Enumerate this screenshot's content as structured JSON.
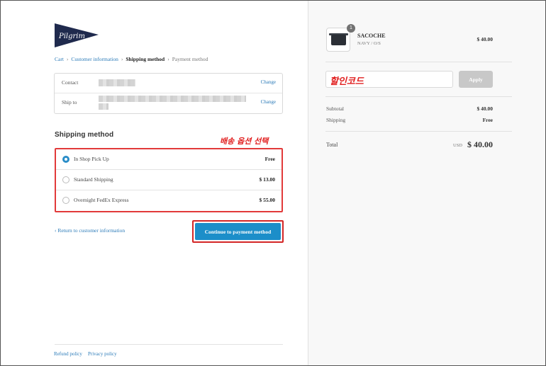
{
  "brand": {
    "logo_text": "Pilgrim"
  },
  "breadcrumb": {
    "items": [
      "Cart",
      "Customer information",
      "Shipping method",
      "Payment method"
    ]
  },
  "review": {
    "contact_label": "Contact",
    "ship_to_label": "Ship to",
    "change_label": "Change"
  },
  "shipping": {
    "title": "Shipping method",
    "annotation": "배송 옵션 선택",
    "options": [
      {
        "name": "In Shop Pick Up",
        "price": "Free",
        "selected": true
      },
      {
        "name": "Standard Shipping",
        "price": "$ 13.00",
        "selected": false
      },
      {
        "name": "Overnight FedEx Express",
        "price": "$ 55.00",
        "selected": false
      }
    ]
  },
  "actions": {
    "return_label": "Return to customer information",
    "continue_label": "Continue to payment method"
  },
  "footer": {
    "refund": "Refund policy",
    "privacy": "Privacy policy"
  },
  "order": {
    "product": {
      "quantity": "1",
      "name": "SACOCHE",
      "variant": "NAVY / O/S",
      "price": "$ 40.00"
    },
    "discount_annotation": "할인코드",
    "apply_label": "Apply",
    "subtotal_label": "Subtotal",
    "subtotal_value": "$ 40.00",
    "shipping_label": "Shipping",
    "shipping_value": "Free",
    "total_label": "Total",
    "currency": "USD",
    "total_value": "$ 40.00"
  },
  "colors": {
    "accent": "#1c8ec9",
    "link": "#2a7ab8",
    "annotation": "#e11f1f",
    "logo": "#1f2a4d"
  }
}
